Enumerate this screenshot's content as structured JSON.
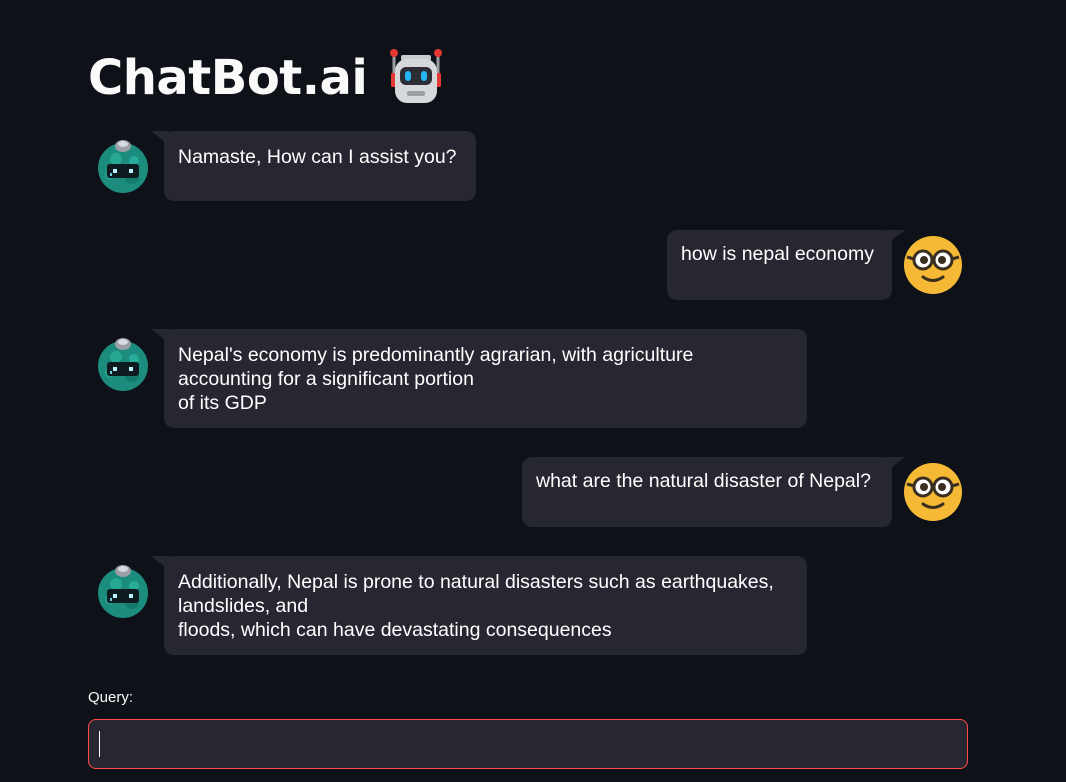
{
  "header": {
    "title": "ChatBot.ai",
    "icon": "robot-icon"
  },
  "messages": [
    {
      "role": "bot",
      "text": "Namaste, How can I assist you?",
      "avatar": "bot-avatar-icon"
    },
    {
      "role": "user",
      "text": "how is nepal economy",
      "avatar": "nerd-face-icon"
    },
    {
      "role": "bot",
      "lines": [
        "Nepal's economy is predominantly agrarian, with agriculture",
        "accounting for a significant portion",
        "of its GDP"
      ],
      "avatar": "bot-avatar-icon"
    },
    {
      "role": "user",
      "text": "what are the natural disaster of Nepal?",
      "avatar": "nerd-face-icon"
    },
    {
      "role": "bot",
      "lines": [
        "Additionally, Nepal is prone to natural disasters such as earthquakes,",
        "landslides, and",
        "floods, which can have devastating consequences"
      ],
      "avatar": "bot-avatar-icon"
    }
  ],
  "query": {
    "label": "Query:",
    "value": "",
    "placeholder": ""
  },
  "colors": {
    "background": "#0e1117",
    "bubble": "#262730",
    "input_border": "#ff4b4b",
    "user_avatar": "#f5b935",
    "bot_avatar": "#1c9e8c"
  }
}
